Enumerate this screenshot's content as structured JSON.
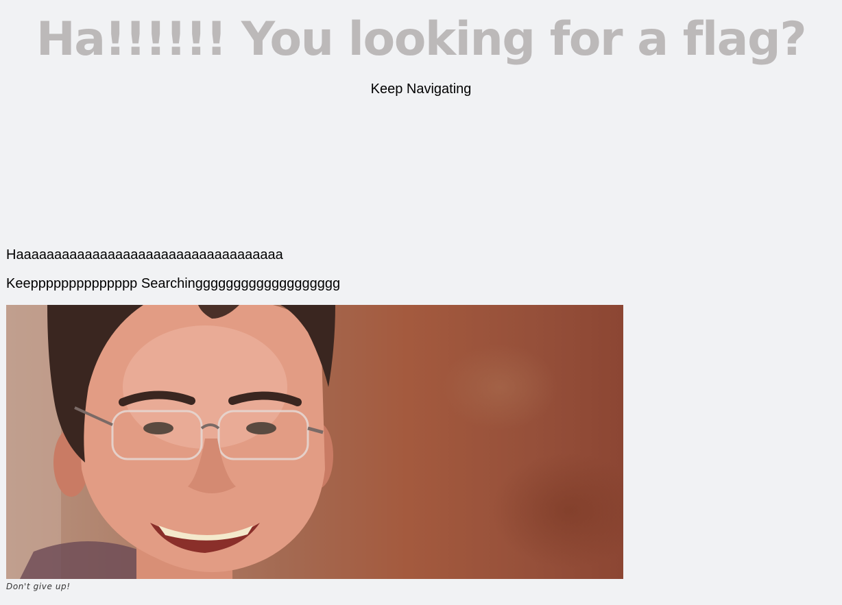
{
  "header": {
    "title": "Ha!!!!!! You looking for a flag?",
    "subtitle": "Keep Navigating"
  },
  "content": {
    "line1": "Haaaaaaaaaaaaaaaaaaaaaaaaaaaaaaaaaaa",
    "line2": "Keepppppppppppppp Searchinggggggggggggggggggg"
  },
  "figure": {
    "caption": "Don't give up!"
  },
  "colors": {
    "background": "#f1f2f4",
    "title": "#bcb9b9",
    "text": "#000000",
    "caption": "#333333"
  }
}
